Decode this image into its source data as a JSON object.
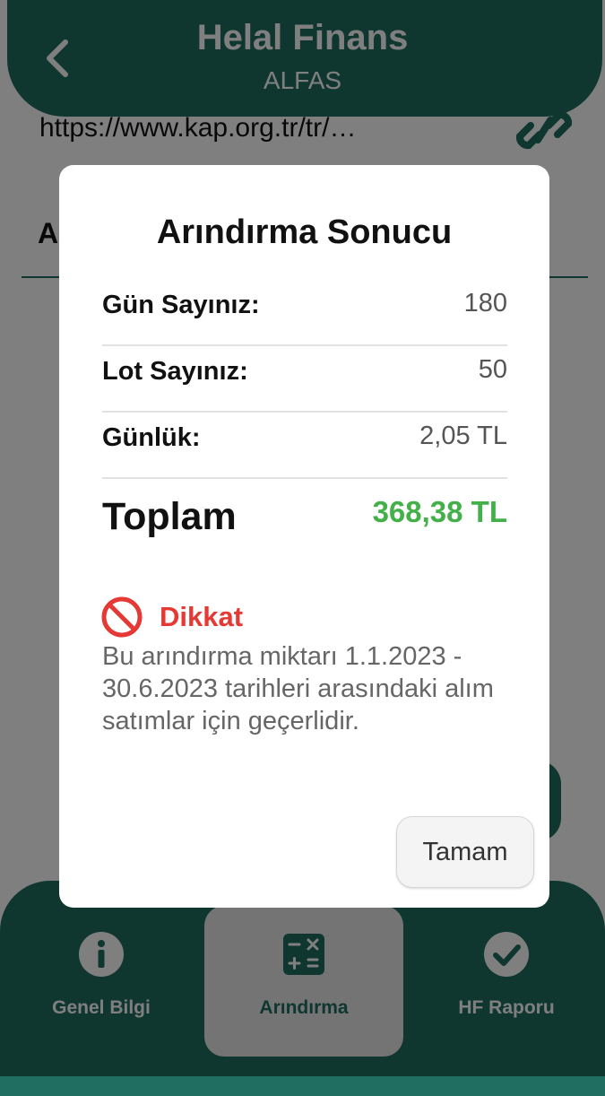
{
  "header": {
    "title": "Helal Finans",
    "subtitle": "ALFAS",
    "back_icon": "chevron-left-icon"
  },
  "content": {
    "url": "https://www.kap.org.tr/tr/…",
    "link_icon": "link-icon",
    "section_initial": "A"
  },
  "dialog": {
    "title": "Arındırma Sonucu",
    "rows": [
      {
        "label": "Gün Sayınız:",
        "value": "180"
      },
      {
        "label": "Lot Sayınız:",
        "value": "50"
      },
      {
        "label": "Günlük:",
        "value": "2,05 TL"
      }
    ],
    "total": {
      "label": "Toplam",
      "value": "368,38 TL"
    },
    "warning": {
      "icon": "block-icon",
      "title": "Dikkat",
      "text": "Bu arındırma miktarı 1.1.2023 - 30.6.2023 tarihleri arasındaki alım satımlar için geçerlidir."
    },
    "ok_label": "Tamam"
  },
  "bottom_nav": {
    "items": [
      {
        "label": "Genel Bilgi",
        "icon": "info-icon",
        "active": false
      },
      {
        "label": "Arındırma",
        "icon": "calculator-icon",
        "active": true
      },
      {
        "label": "HF Raporu",
        "icon": "check-circle-icon",
        "active": false
      }
    ]
  },
  "colors": {
    "primary": "#1f6e61",
    "total_value": "#43b04a",
    "warning": "#e53935"
  }
}
